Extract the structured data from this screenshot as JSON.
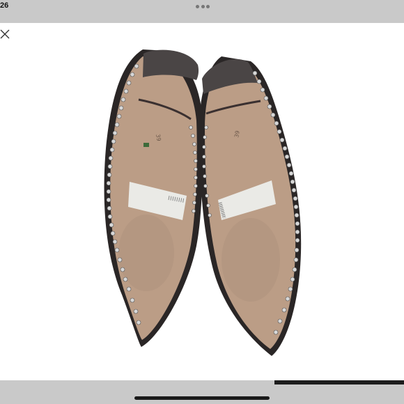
{
  "status_bar": {
    "time": "26"
  },
  "toolbar": {
    "menu_icon": "ellipsis-icon",
    "close_icon": "close-icon"
  },
  "photo": {
    "labels": {
      "size_stamp": "39",
      "sticker_left": "",
      "sticker_right": ""
    }
  },
  "progress": {
    "fraction": 0.32
  },
  "colors": {
    "chrome": "#c9c9c9",
    "sole": "#b89a84",
    "heel_cap": "#4a4545",
    "stud": "#d8d8d8"
  }
}
